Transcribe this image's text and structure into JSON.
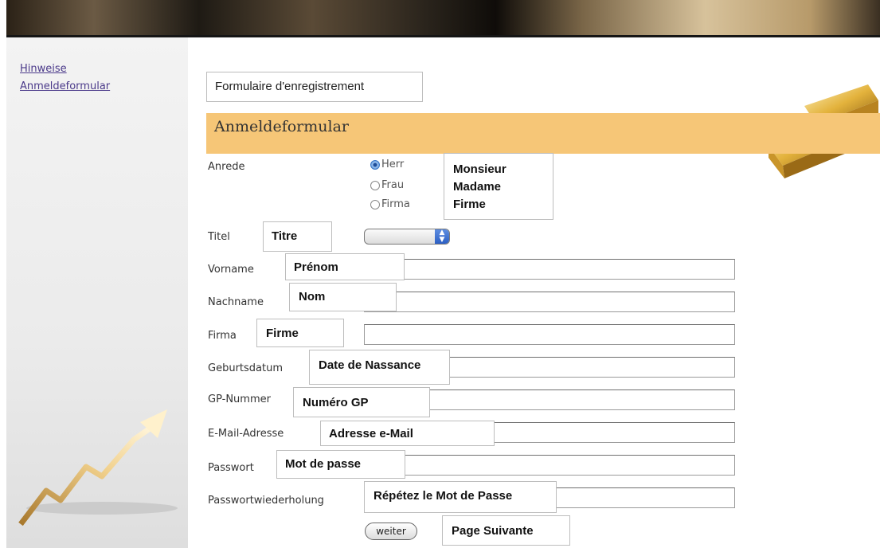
{
  "sidebar": {
    "links": [
      "Hinweise",
      "Anmeldeformular"
    ]
  },
  "form": {
    "translation_title": "Formulaire d'enregistrement",
    "section_heading": "Anmeldeformular",
    "anrede": {
      "label": "Anrede",
      "options": [
        "Herr",
        "Frau",
        "Firma"
      ],
      "selected": "Herr",
      "translation": [
        "Monsieur",
        "Madame",
        "Firme"
      ]
    },
    "titel": {
      "label": "Titel",
      "translation": "Titre",
      "value": ""
    },
    "fields": [
      {
        "label": "Vorname",
        "translation": "Prénom",
        "value": ""
      },
      {
        "label": "Nachname",
        "translation": "Nom",
        "value": ""
      },
      {
        "label": "Firma",
        "translation": "Firme",
        "value": ""
      },
      {
        "label": "Geburtsdatum",
        "translation": "Date de Nassance",
        "value": ""
      },
      {
        "label": "GP-Nummer",
        "translation": "Numéro GP",
        "value": ""
      },
      {
        "label": "E-Mail-Adresse",
        "translation": "Adresse e-Mail",
        "value": ""
      },
      {
        "label": "Passwort",
        "translation": "Mot de passe",
        "value": ""
      },
      {
        "label": "Passwortwiederholung",
        "translation": "Répétez le Mot de Passe",
        "value": ""
      }
    ],
    "submit": {
      "label": "weiter",
      "translation": "Page Suivante"
    }
  },
  "colors": {
    "section_heading_bg": "#f6c677",
    "link": "#4b3a8a",
    "radio_selected": "#3b78c8"
  },
  "icons": [
    "rising-arrow-graphic",
    "gold-bars-graphic",
    "select-arrows-icon"
  ]
}
